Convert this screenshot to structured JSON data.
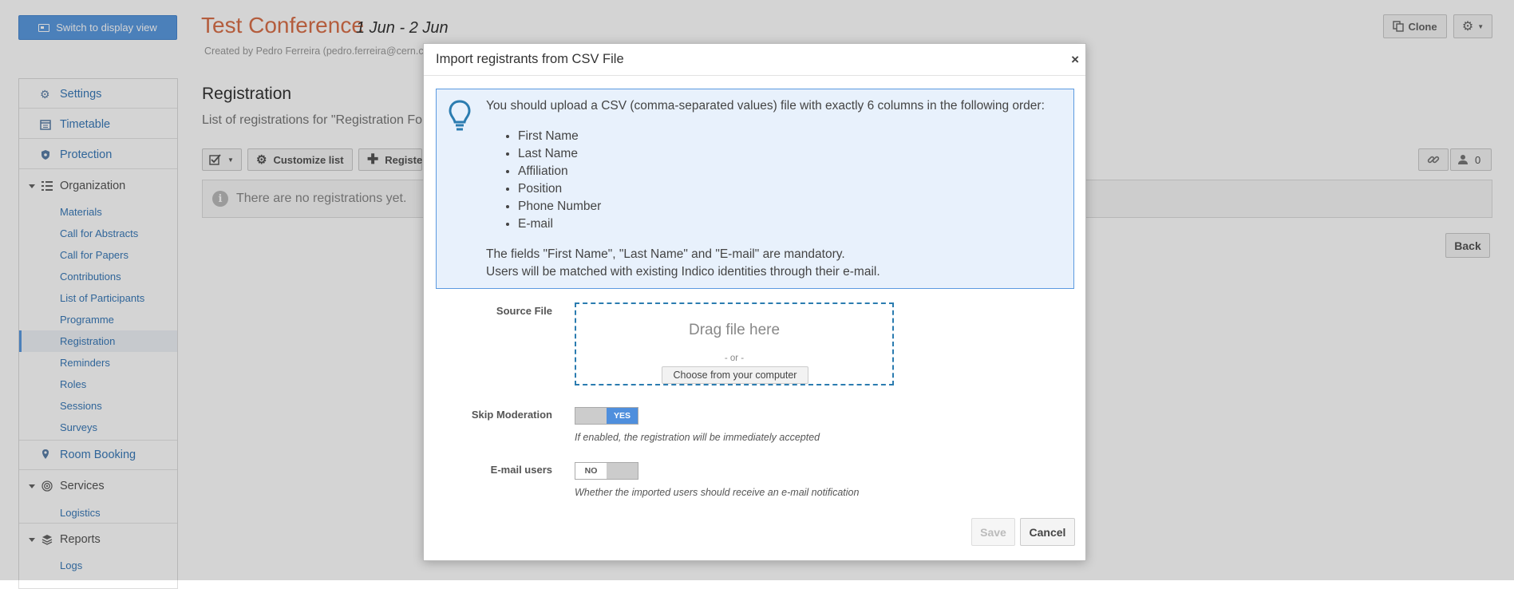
{
  "header": {
    "switch_label": "Switch to display view",
    "title": "Test Conference",
    "dates": "1 Jun - 2 Jun",
    "created_by": "Created by Pedro Ferreira (pedro.ferreira@cern.c",
    "clone_label": "Clone"
  },
  "sidebar": {
    "settings": "Settings",
    "timetable": "Timetable",
    "protection": "Protection",
    "organization": "Organization",
    "org_items": [
      "Materials",
      "Call for Abstracts",
      "Call for Papers",
      "Contributions",
      "List of Participants",
      "Programme",
      "Registration",
      "Reminders",
      "Roles",
      "Sessions",
      "Surveys"
    ],
    "active_item": "Registration",
    "room_booking": "Room Booking",
    "services": "Services",
    "services_items": [
      "Logistics"
    ],
    "reports": "Reports",
    "reports_items": [
      "Logs"
    ]
  },
  "main": {
    "title": "Registration",
    "subtitle": "List of registrations for \"Registration Fo",
    "customize_label": "Customize list",
    "register_label": "Registe",
    "registrant_count": "0",
    "empty_message": "There are no registrations yet.",
    "back_label": "Back"
  },
  "dialog": {
    "title": "Import registrants from CSV File",
    "close": "×",
    "info_lead": "You should upload a CSV (comma-separated values) file with exactly 6 columns in the following order:",
    "columns": [
      "First Name",
      "Last Name",
      "Affiliation",
      "Position",
      "Phone Number",
      "E-mail"
    ],
    "note_line1": "The fields \"First Name\", \"Last Name\" and \"E-mail\" are mandatory.",
    "note_line2": "Users will be matched with existing Indico identities through their e-mail.",
    "source_label": "Source File",
    "drag_text": "Drag file here",
    "or_text": "- or -",
    "choose_label": "Choose from your computer",
    "skip_label": "Skip Moderation",
    "skip_value": "YES",
    "skip_hint": "If enabled, the registration will be immediately accepted",
    "email_label": "E-mail users",
    "email_value": "NO",
    "email_hint": "Whether the imported users should receive an e-mail notification",
    "save_label": "Save",
    "cancel_label": "Cancel"
  },
  "colors": {
    "accent": "#5b9ae0",
    "title_orange": "#d9704a",
    "link": "#3a7ab8",
    "info_bg": "#e8f1fc",
    "dropzone_border": "#2b7cb0"
  }
}
